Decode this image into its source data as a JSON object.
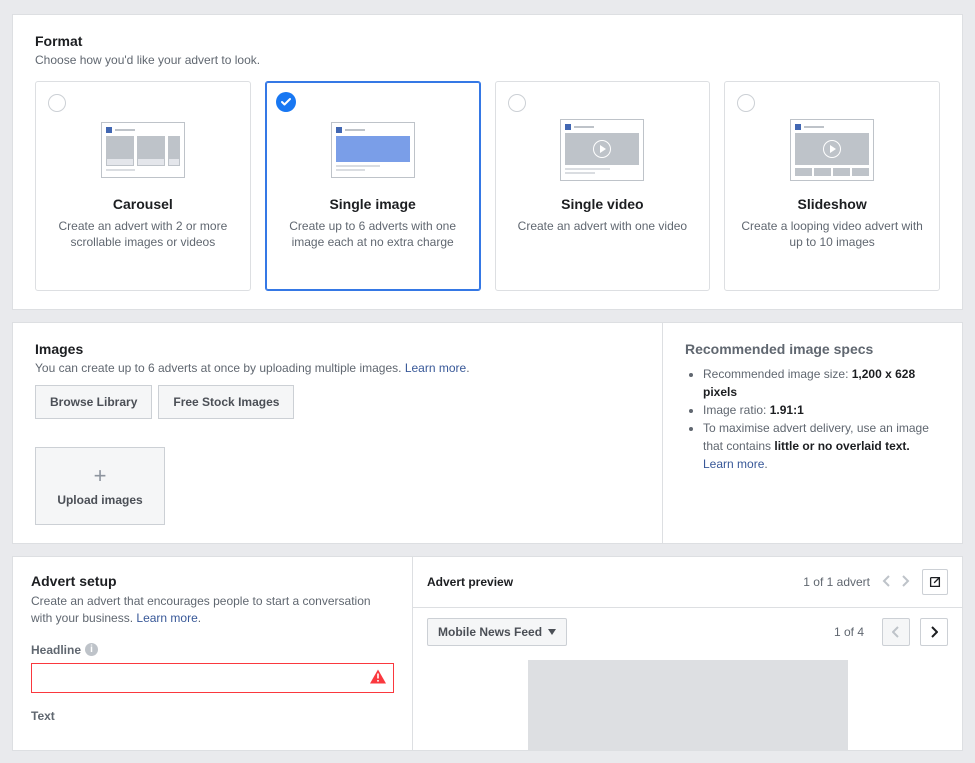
{
  "format": {
    "title": "Format",
    "desc": "Choose how you'd like your advert to look.",
    "options": [
      {
        "title": "Carousel",
        "desc": "Create an advert with 2 or more scrollable images or videos",
        "selected": false
      },
      {
        "title": "Single image",
        "desc": "Create up to 6 adverts with one image each at no extra charge",
        "selected": true
      },
      {
        "title": "Single video",
        "desc": "Create an advert with one video",
        "selected": false
      },
      {
        "title": "Slideshow",
        "desc": "Create a looping video advert with up to 10 images",
        "selected": false
      }
    ]
  },
  "images": {
    "title": "Images",
    "desc": "You can create up to 6 adverts at once by uploading multiple images.",
    "learn_more": "Learn more",
    "browse_library": "Browse Library",
    "free_stock": "Free Stock Images",
    "upload_label": "Upload images"
  },
  "specs": {
    "title": "Recommended image specs",
    "size_label": "Recommended image size:",
    "size_value": "1,200 x 628 pixels",
    "ratio_label": "Image ratio:",
    "ratio_value": "1.91:1",
    "delivery_prefix": "To maximise advert delivery, use an image that contains",
    "delivery_bold": "little or no overlaid text.",
    "learn_more": "Learn more"
  },
  "setup": {
    "title": "Advert setup",
    "desc": "Create an advert that encourages people to start a conversation with your business.",
    "learn_more": "Learn more",
    "headline_label": "Headline",
    "headline_value": "",
    "text_label": "Text"
  },
  "preview": {
    "title": "Advert preview",
    "ad_pager": "1 of 1 advert",
    "dropdown": "Mobile News Feed",
    "variant_pager": "1 of 4"
  }
}
